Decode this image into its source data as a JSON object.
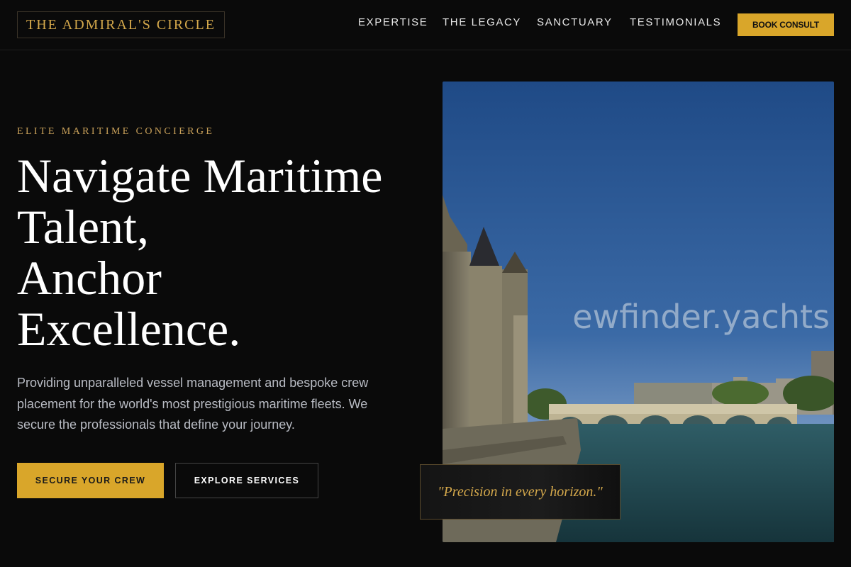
{
  "header": {
    "logo": "THE ADMIRAL'S CIRCLE",
    "nav": [
      "EXPERTISE",
      "THE LEGACY",
      "SANCTUARY",
      "TESTIMONIALS"
    ],
    "cta": "BOOK CONSULT"
  },
  "hero": {
    "eyebrow": "ELITE MARITIME CONCIERGE",
    "headline": [
      "Navigate Maritime",
      "Talent,",
      "Anchor",
      "Excellence."
    ],
    "description": "Providing unparalleled vessel management and bespoke crew placement for the world's most prestigious maritime fleets. We secure the professionals that define your journey.",
    "primary_button": "SECURE YOUR CREW",
    "secondary_button": "EXPLORE SERVICES"
  },
  "image": {
    "watermark": "ewfinder.yachts",
    "quote": "\"Precision in every horizon.\""
  },
  "colors": {
    "background": "#0a0a0a",
    "accent": "#d9a62a",
    "gold_text": "#d4a84b"
  }
}
